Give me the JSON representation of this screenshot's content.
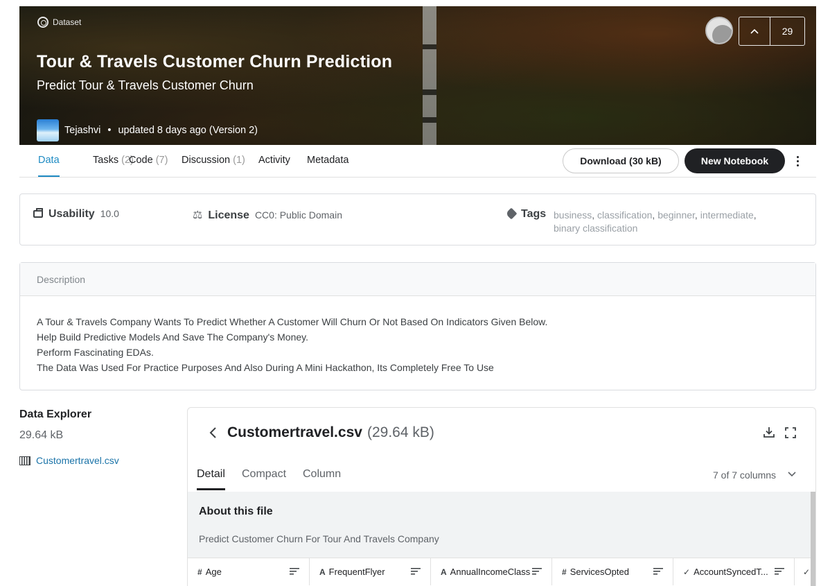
{
  "hero": {
    "kind": "Dataset",
    "title": "Tour & Travels Customer Churn Prediction",
    "subtitle": "Predict Tour & Travels Customer Churn",
    "author": "Tejashvi",
    "updated": "updated 8 days ago (Version 2)",
    "upvotes": "29"
  },
  "tabs": [
    {
      "label": "Data",
      "count": ""
    },
    {
      "label": "Tasks",
      "count": "(2)"
    },
    {
      "label": "Code",
      "count": "(7)"
    },
    {
      "label": "Discussion",
      "count": "(1)"
    },
    {
      "label": "Activity",
      "count": ""
    },
    {
      "label": "Metadata",
      "count": ""
    }
  ],
  "actions": {
    "download": "Download (30 kB)",
    "new_notebook": "New Notebook"
  },
  "meta": {
    "usability_label": "Usability",
    "usability_value": "10.0",
    "license_label": "License",
    "license_value": "CC0: Public Domain",
    "tags_label": "Tags",
    "tags": [
      "business",
      "classification",
      "beginner",
      "intermediate",
      "binary classification"
    ]
  },
  "description": {
    "header": "Description",
    "lines": [
      "A Tour & Travels Company Wants To Predict Whether A Customer Will Churn Or Not Based On Indicators Given Below.",
      "Help Build Predictive Models And Save The Company's Money.",
      "Perform Fascinating EDAs.",
      "The Data Was Used For Practice Purposes And Also During A Mini Hackathon, Its Completely Free To Use"
    ]
  },
  "explorer": {
    "title": "Data Explorer",
    "size": "29.64 kB",
    "file": "Customertravel.csv"
  },
  "panel": {
    "file_name": "Customertravel.csv",
    "file_size": "(29.64 kB)",
    "tabs": [
      "Detail",
      "Compact",
      "Column"
    ],
    "columns_selector": "7 of 7 columns",
    "about_title": "About this file",
    "about_text": "Predict Customer Churn For Tour And Travels Company",
    "columns": [
      {
        "type": "#",
        "name": "Age"
      },
      {
        "type": "A",
        "name": "FrequentFlyer"
      },
      {
        "type": "A",
        "name": "AnnualIncomeClass"
      },
      {
        "type": "#",
        "name": "ServicesOpted"
      },
      {
        "type": "✓",
        "name": "AccountSyncedT..."
      },
      {
        "type": "✓",
        "name": ""
      }
    ]
  },
  "colors": {
    "accent": "#1e8bc3",
    "dark_button": "#202124"
  }
}
